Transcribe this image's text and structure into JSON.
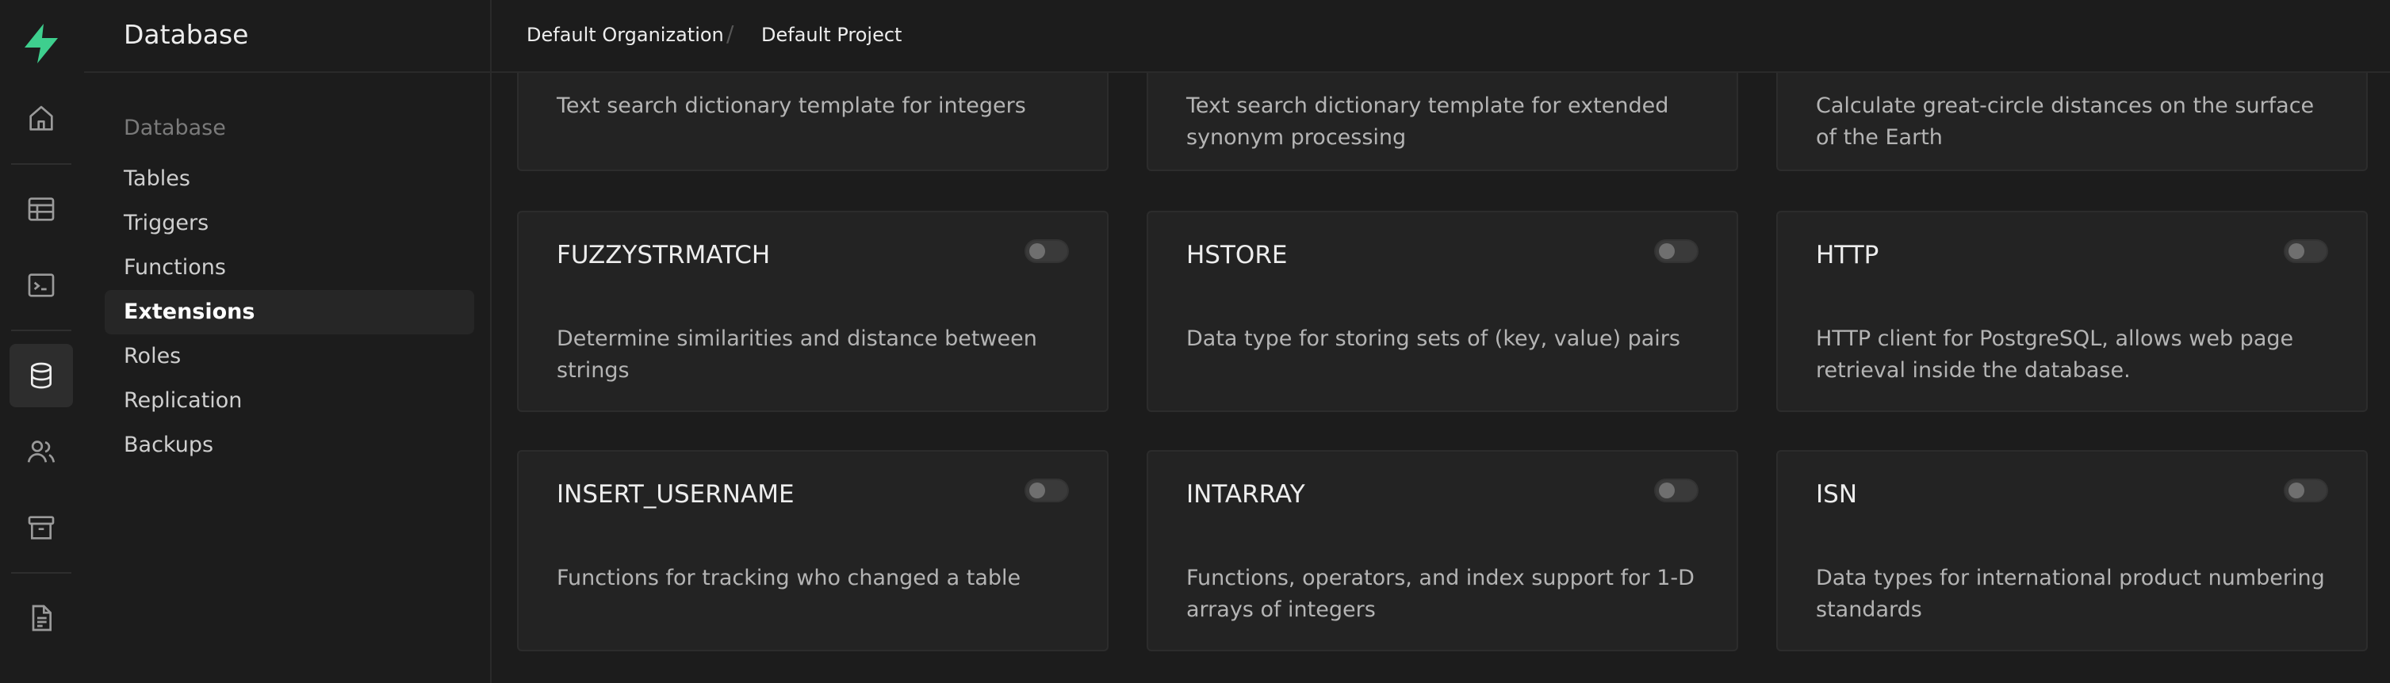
{
  "app": {
    "brand_icon": "supabase-logo-icon",
    "accent_color": "#3ecf8e"
  },
  "rail": {
    "icons": [
      "home-icon",
      "table-editor-icon",
      "sql-editor-icon",
      "database-icon",
      "auth-users-icon",
      "storage-icon",
      "docs-icon"
    ]
  },
  "sidebar": {
    "title": "Database",
    "section_label": "Database",
    "items": [
      {
        "label": "Tables"
      },
      {
        "label": "Triggers"
      },
      {
        "label": "Functions"
      },
      {
        "label": "Extensions",
        "active": true
      },
      {
        "label": "Roles"
      },
      {
        "label": "Replication"
      },
      {
        "label": "Backups"
      }
    ]
  },
  "breadcrumb": {
    "organization": "Default Organization",
    "separator": "/",
    "project": "Default Project"
  },
  "extensions": {
    "partial_row": [
      {
        "description": "Text search dictionary template for integers"
      },
      {
        "description": "Text search dictionary template for extended synonym processing"
      },
      {
        "description": "Calculate great-circle distances on the surface of the Earth"
      }
    ],
    "rows": [
      [
        {
          "name": "FUZZYSTRMATCH",
          "description": "Determine similarities and distance between strings",
          "enabled": false
        },
        {
          "name": "HSTORE",
          "description": "Data type for storing sets of (key, value) pairs",
          "enabled": false
        },
        {
          "name": "HTTP",
          "description": "HTTP client for PostgreSQL, allows web page retrieval inside the database.",
          "enabled": false
        }
      ],
      [
        {
          "name": "INSERT_USERNAME",
          "description": "Functions for tracking who changed a table",
          "enabled": false
        },
        {
          "name": "INTARRAY",
          "description": "Functions, operators, and index support for 1-D arrays of integers",
          "enabled": false
        },
        {
          "name": "ISN",
          "description": "Data types for international product numbering standards",
          "enabled": false
        }
      ]
    ]
  }
}
